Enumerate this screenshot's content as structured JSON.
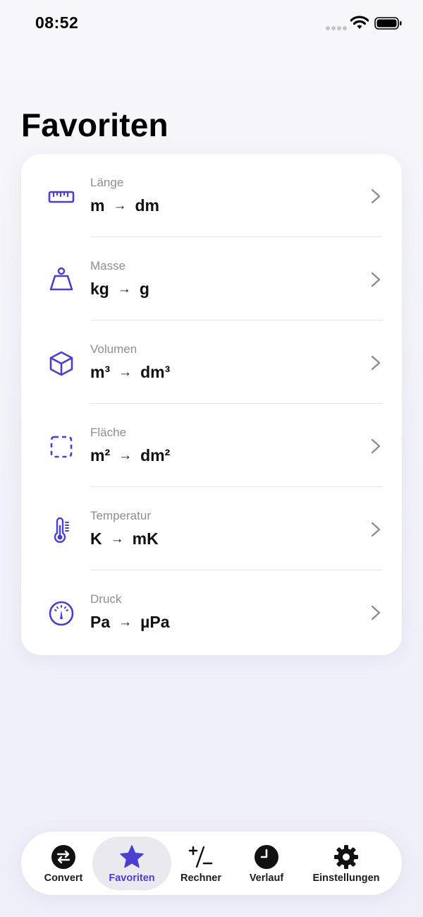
{
  "status_bar": {
    "time": "08:52"
  },
  "page": {
    "title": "Favoriten"
  },
  "favorites": [
    {
      "category": "Länge",
      "from": "m",
      "to": "dm",
      "icon": "ruler-icon"
    },
    {
      "category": "Masse",
      "from": "kg",
      "to": "g",
      "icon": "weight-icon"
    },
    {
      "category": "Volumen",
      "from": "m³",
      "to": "dm³",
      "icon": "cube-icon"
    },
    {
      "category": "Fläche",
      "from": "m²",
      "to": "dm²",
      "icon": "area-square-icon"
    },
    {
      "category": "Temperatur",
      "from": "K",
      "to": "mK",
      "icon": "thermometer-icon"
    },
    {
      "category": "Druck",
      "from": "Pa",
      "to": "µPa",
      "icon": "gauge-icon"
    }
  ],
  "arrow": "→",
  "tabs": [
    {
      "label": "Convert",
      "icon": "convert-arrows-icon",
      "active": false
    },
    {
      "label": "Favoriten",
      "icon": "star-icon",
      "active": true
    },
    {
      "label": "Rechner",
      "icon": "plus-minus-icon",
      "active": false
    },
    {
      "label": "Verlauf",
      "icon": "clock-icon",
      "active": false
    },
    {
      "label": "Einstellungen",
      "icon": "gear-icon",
      "active": false
    }
  ],
  "colors": {
    "accent": "#4b3fd0",
    "background": "#f3f3f9",
    "card": "#ffffff",
    "secondary_text": "#8e8e93"
  }
}
